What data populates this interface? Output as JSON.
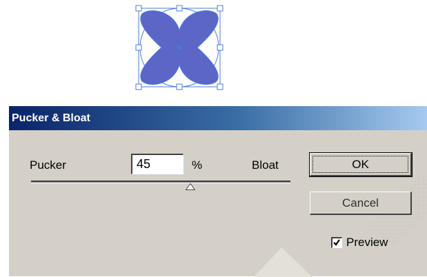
{
  "dialog": {
    "title": "Pucker & Bloat",
    "pucker_label": "Pucker",
    "bloat_label": "Bloat",
    "amount_value": "45",
    "percent_sign": "%",
    "ok_label": "OK",
    "cancel_label": "Cancel",
    "preview_label": "Preview",
    "preview_checked": true,
    "slider_value_percent": 45
  },
  "colors": {
    "shape_fill": "#5b66c6",
    "selection_handle": "#4a7ae0",
    "dialog_bg": "#d4d0c8",
    "title_start": "#0a246a",
    "title_end": "#a6caf0"
  },
  "icons": {
    "thumb": "slider-thumb-icon",
    "check": "check-icon"
  }
}
